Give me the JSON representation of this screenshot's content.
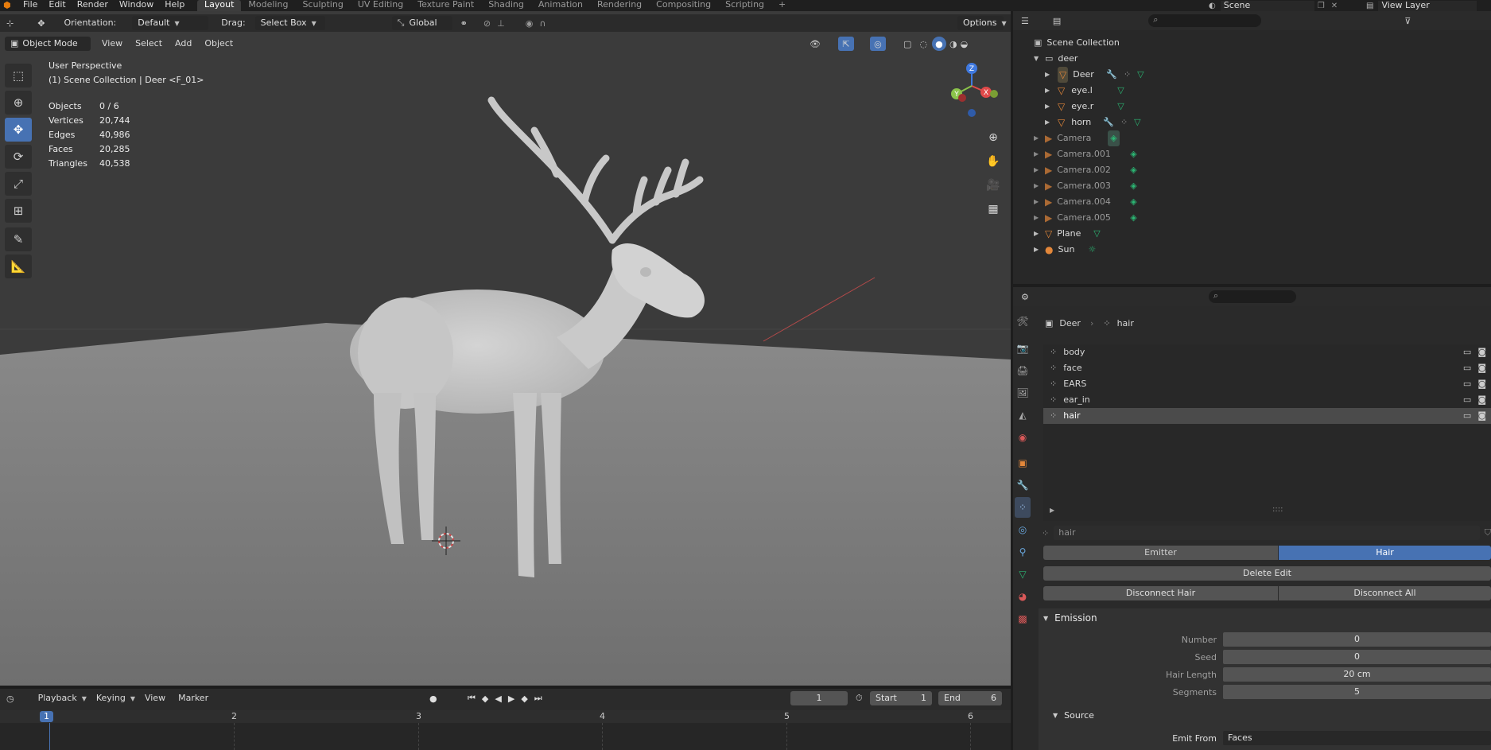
{
  "topbar": {
    "menus": [
      "File",
      "Edit",
      "Render",
      "Window",
      "Help"
    ],
    "workspaces": [
      "Layout",
      "Modeling",
      "Sculpting",
      "UV Editing",
      "Texture Paint",
      "Shading",
      "Animation",
      "Rendering",
      "Compositing",
      "Scripting"
    ],
    "add_tab": "+",
    "scene_label": "Scene",
    "view_layer_label": "View Layer"
  },
  "viewport": {
    "header": {
      "orientation_label": "Orientation:",
      "orientation_value": "Default",
      "drag_label": "Drag:",
      "drag_value": "Select Box",
      "transform_space": "Global",
      "options": "Options"
    },
    "header2": {
      "mode": "Object Mode",
      "menus": [
        "View",
        "Select",
        "Add",
        "Object"
      ]
    },
    "overlay": {
      "perspective": "User Perspective",
      "collection": "(1) Scene Collection | Deer <F_01>",
      "stats": [
        {
          "label": "Objects",
          "value": "0 / 6"
        },
        {
          "label": "Vertices",
          "value": "20,744"
        },
        {
          "label": "Edges",
          "value": "40,986"
        },
        {
          "label": "Faces",
          "value": "20,285"
        },
        {
          "label": "Triangles",
          "value": "40,538"
        }
      ]
    },
    "gizmo": {
      "z": "Z",
      "y": "Y",
      "x": "X"
    }
  },
  "outliner": {
    "root": "Scene Collection",
    "collection": "deer",
    "items": [
      {
        "name": "Deer",
        "dim": false
      },
      {
        "name": "eye.l",
        "dim": false
      },
      {
        "name": "eye.r",
        "dim": false
      },
      {
        "name": "horn",
        "dim": false
      }
    ],
    "others": [
      {
        "name": "Camera",
        "dim": true
      },
      {
        "name": "Camera.001",
        "dim": true
      },
      {
        "name": "Camera.002",
        "dim": true
      },
      {
        "name": "Camera.003",
        "dim": true
      },
      {
        "name": "Camera.004",
        "dim": true
      },
      {
        "name": "Camera.005",
        "dim": true
      },
      {
        "name": "Plane",
        "dim": false
      },
      {
        "name": "Sun",
        "dim": false
      }
    ]
  },
  "properties": {
    "breadcrumb": {
      "object": "Deer",
      "system": "hair"
    },
    "systems": [
      "body",
      "face",
      "EARS",
      "ear_in",
      "hair"
    ],
    "selected_system": "hair",
    "name_field": "hair",
    "type_buttons": {
      "emitter": "Emitter",
      "hair": "Hair"
    },
    "delete_edit": "Delete Edit",
    "disconnect_hair": "Disconnect Hair",
    "disconnect_all": "Disconnect All",
    "emission": {
      "title": "Emission",
      "fields": [
        {
          "label": "Number",
          "value": "0"
        },
        {
          "label": "Seed",
          "value": "0"
        },
        {
          "label": "Hair Length",
          "value": "20 cm"
        },
        {
          "label": "Segments",
          "value": "5"
        }
      ],
      "source_title": "Source",
      "emit_from_label": "Emit From",
      "emit_from_value": "Faces"
    }
  },
  "timeline": {
    "playback": "Playback",
    "keying": "Keying",
    "view": "View",
    "marker": "Marker",
    "current_frame": "1",
    "start_label": "Start",
    "start_value": "1",
    "end_label": "End",
    "end_value": "6",
    "frames": [
      "1",
      "2",
      "3",
      "4",
      "5",
      "6"
    ]
  },
  "colors": {
    "accent": "#4772b3",
    "panel": "#2b2b2b",
    "viewport": "#3a3a3a",
    "axis_x": "#e04a4a",
    "axis_y": "#8bc34a",
    "axis_z": "#3f79e0"
  }
}
